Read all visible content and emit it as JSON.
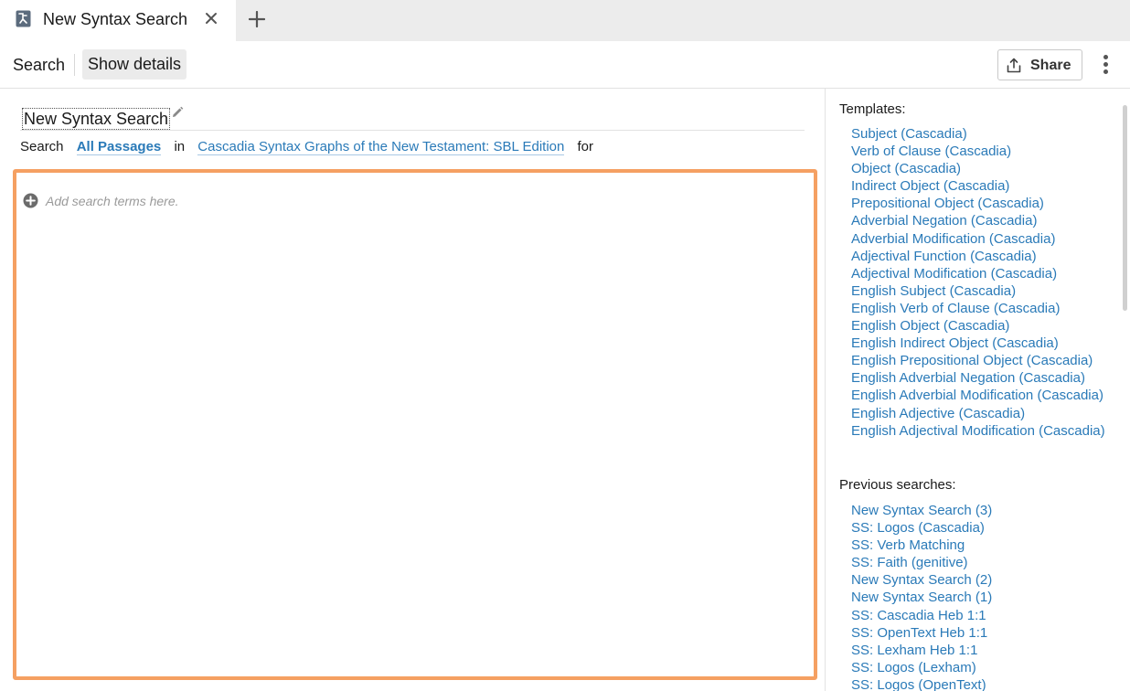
{
  "tab": {
    "title": "New Syntax Search",
    "icon": "syntax-graph-icon"
  },
  "toolbar": {
    "search_label": "Search",
    "details_label": "Show details",
    "share_label": "Share"
  },
  "main": {
    "title": "New Syntax Search",
    "search_word": "Search",
    "range": "All Passages",
    "in_word": "in",
    "resource": "Cascadia Syntax Graphs of the New Testament: SBL Edition",
    "for_word": "for",
    "placeholder": "Add search terms here."
  },
  "panel": {
    "templates_heading": "Templates:",
    "templates": [
      "Subject (Cascadia)",
      "Verb of Clause (Cascadia)",
      "Object (Cascadia)",
      "Indirect Object (Cascadia)",
      "Prepositional Object (Cascadia)",
      "Adverbial Negation (Cascadia)",
      "Adverbial Modification (Cascadia)",
      "Adjectival Function (Cascadia)",
      "Adjectival Modification (Cascadia)",
      "English Subject (Cascadia)",
      "English Verb of Clause (Cascadia)",
      "English Object (Cascadia)",
      "English Indirect Object (Cascadia)",
      "English Prepositional Object (Cascadia)",
      "English Adverbial Negation (Cascadia)",
      "English Adverbial Modification (Cascadia)",
      "English Adjective (Cascadia)",
      "English Adjectival Modification (Cascadia)"
    ],
    "previous_heading": "Previous searches:",
    "previous": [
      "New Syntax Search (3)",
      "SS: Logos (Cascadia)",
      "SS: Verb Matching",
      "SS: Faith (genitive)",
      "New Syntax Search (2)",
      "New Syntax Search (1)",
      "SS: Cascadia Heb 1:1",
      "SS: OpenText Heb 1:1",
      "SS: Lexham Heb 1:1",
      "SS: Logos (Lexham)",
      "SS: Logos (OpenText)"
    ]
  },
  "colors": {
    "link": "#2a7ab8",
    "query_border": "#f5a062",
    "tabbar_bg": "#ececec"
  }
}
